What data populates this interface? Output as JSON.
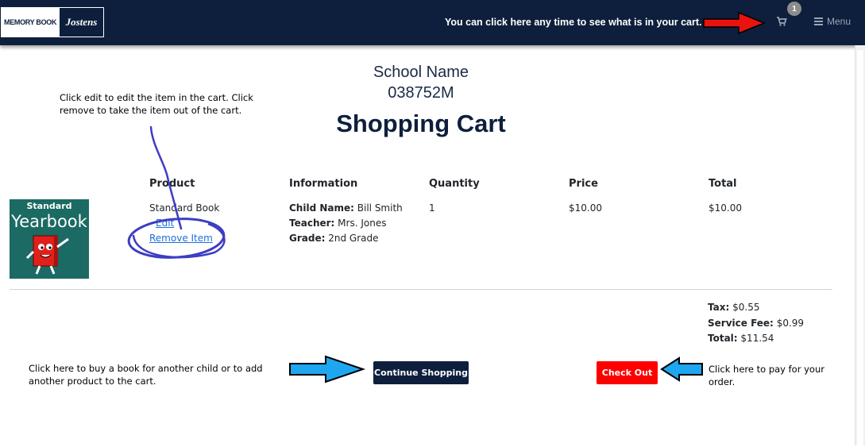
{
  "header": {
    "logo_left": "MEMORY BOOK",
    "logo_right": "Jostens",
    "hint": "You can click here any time to see what is in your cart.",
    "cart_count": "1",
    "menu_label": "Menu"
  },
  "school": {
    "name": "School Name",
    "code": "038752M"
  },
  "page_title": "Shopping Cart",
  "annotations": {
    "edit_help": "Click edit to edit the item in the cart.  Click remove to take the item out of the cart.",
    "continue_help": "Click here to buy a book for another child or to add another product to the cart.",
    "checkout_help": "Click here to pay for your order."
  },
  "table": {
    "headers": {
      "product": "Product",
      "information": "Information",
      "quantity": "Quantity",
      "price": "Price",
      "total": "Total"
    },
    "row": {
      "image_top": "Standard",
      "image_main": "Yearbook",
      "product_name": "Standard Book",
      "edit_label": "Edit",
      "remove_label": "Remove Item",
      "child_label": "Child Name:",
      "child_value": "Bill Smith",
      "teacher_label": "Teacher:",
      "teacher_value": "Mrs. Jones",
      "grade_label": "Grade:",
      "grade_value": "2nd Grade",
      "quantity": "1",
      "price": "$10.00",
      "total": "$10.00"
    }
  },
  "summary": {
    "tax_label": "Tax:",
    "tax_value": "$0.55",
    "fee_label": "Service Fee:",
    "fee_value": "$0.99",
    "total_label": "Total:",
    "total_value": "$11.54"
  },
  "buttons": {
    "continue": "Continue Shopping",
    "checkout": "Check Out"
  },
  "colors": {
    "navbar": "#0d1f3c",
    "checkout": "#ff0000",
    "link": "#1e6fd9",
    "annotation_arrow_blue": "#1ea7f0",
    "annotation_arrow_red": "#e8130f",
    "annotation_scribble": "#3d3dc4"
  }
}
